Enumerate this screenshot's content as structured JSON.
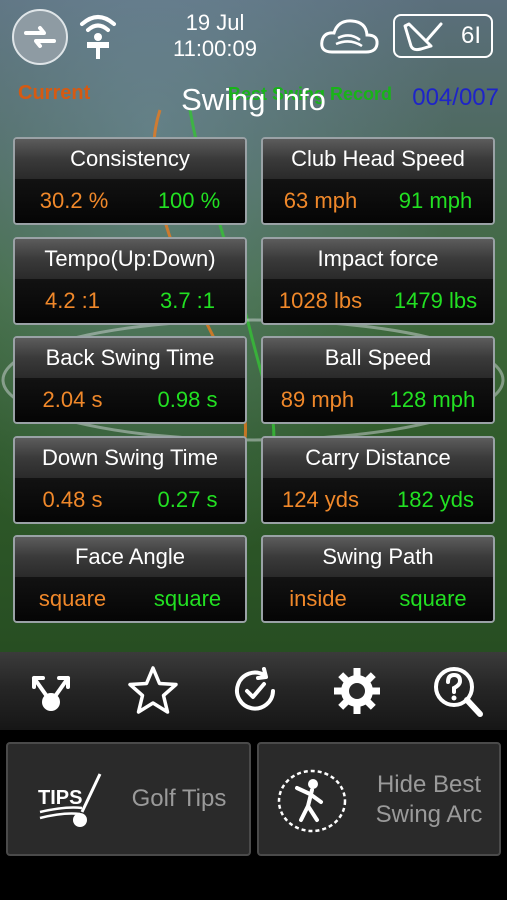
{
  "status": {
    "date": "19 Jul",
    "time": "11:00:09"
  },
  "club": {
    "name": "6I"
  },
  "header": {
    "current_label": "Current",
    "best_label": "Best Swing Record",
    "title": "Swing Info",
    "counter": "004/007"
  },
  "colors": {
    "current": "#f0882a",
    "best": "#22e022",
    "counter": "#1e24c8"
  },
  "metrics": [
    {
      "label": "Consistency",
      "current": "30.2 %",
      "best": "100 %"
    },
    {
      "label": "Club Head Speed",
      "current": "63 mph",
      "best": "91 mph"
    },
    {
      "label": "Tempo(Up:Down)",
      "current": "4.2 :1",
      "best": "3.7 :1"
    },
    {
      "label": "Impact force",
      "current": "1028 lbs",
      "best": "1479 lbs"
    },
    {
      "label": "Back Swing Time",
      "current": "2.04 s",
      "best": "0.98 s"
    },
    {
      "label": "Ball Speed",
      "current": "89 mph",
      "best": "128 mph"
    },
    {
      "label": "Down Swing Time",
      "current": "0.48 s",
      "best": "0.27 s"
    },
    {
      "label": "Carry Distance",
      "current": "124 yds",
      "best": "182 yds"
    },
    {
      "label": "Face Angle",
      "current": "square",
      "best": "square"
    },
    {
      "label": "Swing Path",
      "current": "inside",
      "best": "square"
    }
  ],
  "toolbar": {
    "icons": [
      "share-icon",
      "star-icon",
      "history-icon",
      "settings-icon",
      "help-icon"
    ]
  },
  "bottom": {
    "golf_tips": {
      "icon_text": "TIPS",
      "label": "Golf Tips"
    },
    "swing_arc": {
      "line1": "Hide Best",
      "line2": "Swing Arc"
    }
  }
}
